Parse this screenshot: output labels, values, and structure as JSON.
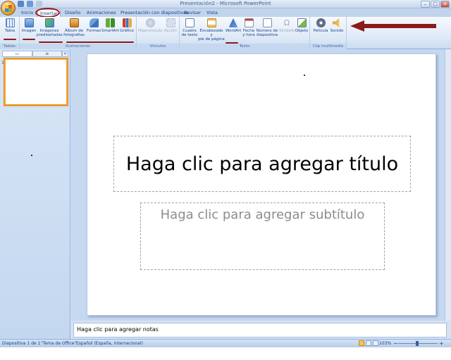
{
  "window": {
    "title": "Presentación2 - Microsoft PowerPoint",
    "controls": {
      "minimize": "–",
      "maximize": "□",
      "close": "✕"
    }
  },
  "tabs": [
    {
      "label": "Inicio"
    },
    {
      "label": "Insertar"
    },
    {
      "label": "Diseño"
    },
    {
      "label": "Animaciones"
    },
    {
      "label": "Presentación con diapositivas"
    },
    {
      "label": "Revisar"
    },
    {
      "label": "Vista"
    }
  ],
  "ribbon": {
    "groups": {
      "tablas": "Tablas",
      "ilustraciones": "Ilustraciones",
      "vinculos": "Vínculos",
      "texto": "Texto",
      "multimedia": "Clip multimedia"
    },
    "buttons": {
      "tabla": "Tabla",
      "imagen": "Imagen",
      "imagenes_pred_1": "Imágenes",
      "imagenes_pred_2": "prediseñadas",
      "album_1": "Álbum de",
      "album_2": "fotografías",
      "formas": "Formas",
      "smartart": "SmartArt",
      "grafico": "Gráfico",
      "hipervinculo": "Hipervínculo",
      "accion": "Acción",
      "cuadro_1": "Cuadro",
      "cuadro_2": "de texto",
      "encabezado_1": "Encabezado y",
      "encabezado_2": "pie de página",
      "wordart": "WordArt",
      "fecha_1": "Fecha",
      "fecha_2": "y hora",
      "numero_1": "Número de",
      "numero_2": "diapositiva",
      "simbolo": "Símbolo",
      "objeto": "Objeto",
      "pelicula": "Película",
      "sonido": "Sonido"
    }
  },
  "left_pane": {
    "slide_number": "1"
  },
  "slide": {
    "title_placeholder": "Haga clic para agregar título",
    "subtitle_placeholder": "Haga clic para agregar subtítulo"
  },
  "notes": {
    "placeholder": "Haga clic para agregar notas"
  },
  "status": {
    "slide_info": "Diapositiva 1 de 1",
    "theme": "\"Tema de Office\"",
    "language": "Español (España, internacional)",
    "zoom": "103%"
  },
  "colors": {
    "accent": "#15428b",
    "annotation": "#8b1a1a",
    "selection": "#f3a53c"
  }
}
